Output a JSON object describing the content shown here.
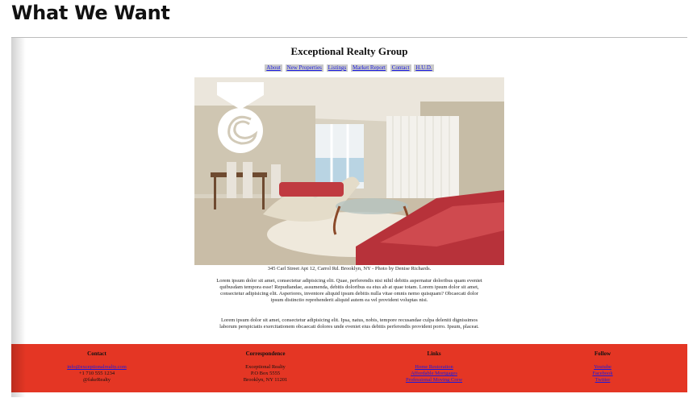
{
  "heading": "What We Want",
  "site": {
    "title": "Exceptional Realty Group",
    "nav": [
      "About",
      "New Properties",
      "Listings",
      "Market Report",
      "Contact",
      "H.U.D."
    ],
    "caption": "345 Carl Street Apt 12, Carrol Rd. Brooklyn, NY - Photo by Denise Richards.",
    "paragraphs": [
      "Lorem ipsum dolor sit amet, consectetur adipisicing elit. Quae, perferendis nisi nihil debitis aspernatur doloribus quam eveniet quibusdam tempora esse! Repudiandae, assumenda, debitis doloribus ea eius ab at quae totam. Lorem ipsum dolor sit amet, consectetur adipisicing elit. Asperiores, inventore aliquid ipsum debitis nulla vitae omnis nemo quisquam? Obcaecati dolor ipsum distinctio reprehenderit aliquid autem ea vel provident voluptas nisi.",
      "Lorem ipsum dolor sit amet, consectetur adipisicing elit. Ipsa, natus, nobis, tempore recusandae culpa deleniti dignissimos laborum perspiciatis exercitationem obcaecati dolores unde eveniet eius debitis perferendis provident porro. Ipsum, placeat."
    ]
  },
  "footer": {
    "contact": {
      "title": "Contact",
      "email": "info@exceptionalrealty.com",
      "phone": "+1 710 555 1234",
      "handle": "@fakeRealty"
    },
    "correspondence": {
      "title": "Correspondence",
      "lines": [
        "Exceptional Realty",
        "P.O Box 5555",
        "Brooklyn, NY 11201"
      ]
    },
    "links": {
      "title": "Links",
      "items": [
        "Home Restoration",
        "Affordable Mortgages",
        "Professional Moving Crew"
      ]
    },
    "follow": {
      "title": "Follow",
      "items": [
        "Youtube",
        "Facebook",
        "Twitter"
      ]
    }
  },
  "colors": {
    "footer_bg": "#e43624",
    "link": "#1a1ae0",
    "nav_bg": "#c9c9c9"
  }
}
